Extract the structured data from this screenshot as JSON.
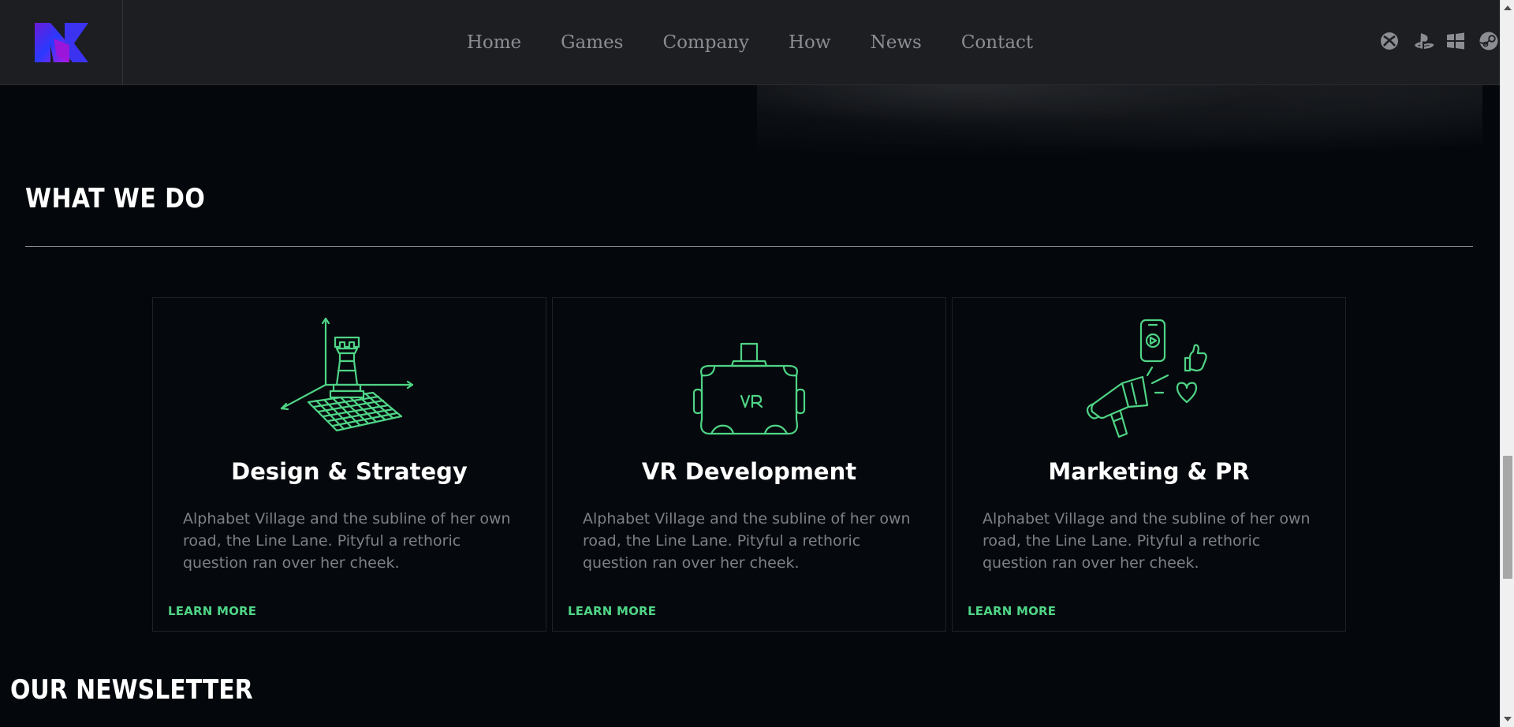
{
  "nav": {
    "items": [
      {
        "label": "Home"
      },
      {
        "label": "Games"
      },
      {
        "label": "Company"
      },
      {
        "label": "How"
      },
      {
        "label": "News"
      },
      {
        "label": "Contact"
      }
    ],
    "platform_icons": [
      "xbox-icon",
      "playstation-icon",
      "windows-icon",
      "steam-icon"
    ]
  },
  "colors": {
    "accent": "#4fd486",
    "logo_gradient": [
      "#6a1bd6",
      "#2a39ff",
      "#b01adf"
    ],
    "header_bg": "#1d1e22",
    "page_bg": "#04080c"
  },
  "what_we_do": {
    "title": "WHAT WE DO",
    "cards": [
      {
        "icon": "chess-rook-strategy-icon",
        "title": "Design & Strategy",
        "text": "Alphabet Village and the subline of her own road, the Line Lane. Pityful a rethoric question ran over her cheek.",
        "link": "LEARN MORE"
      },
      {
        "icon": "vr-headset-icon",
        "title": "VR Development",
        "text": "Alphabet Village and the subline of her own road, the Line Lane. Pityful a rethoric question ran over her cheek.",
        "link": "LEARN MORE"
      },
      {
        "icon": "megaphone-marketing-icon",
        "title": "Marketing & PR",
        "text": "Alphabet Village and the subline of her own road, the Line Lane. Pityful a rethoric question ran over her cheek.",
        "link": "LEARN MORE"
      }
    ]
  },
  "newsletter": {
    "title": "OUR NEWSLETTER"
  }
}
